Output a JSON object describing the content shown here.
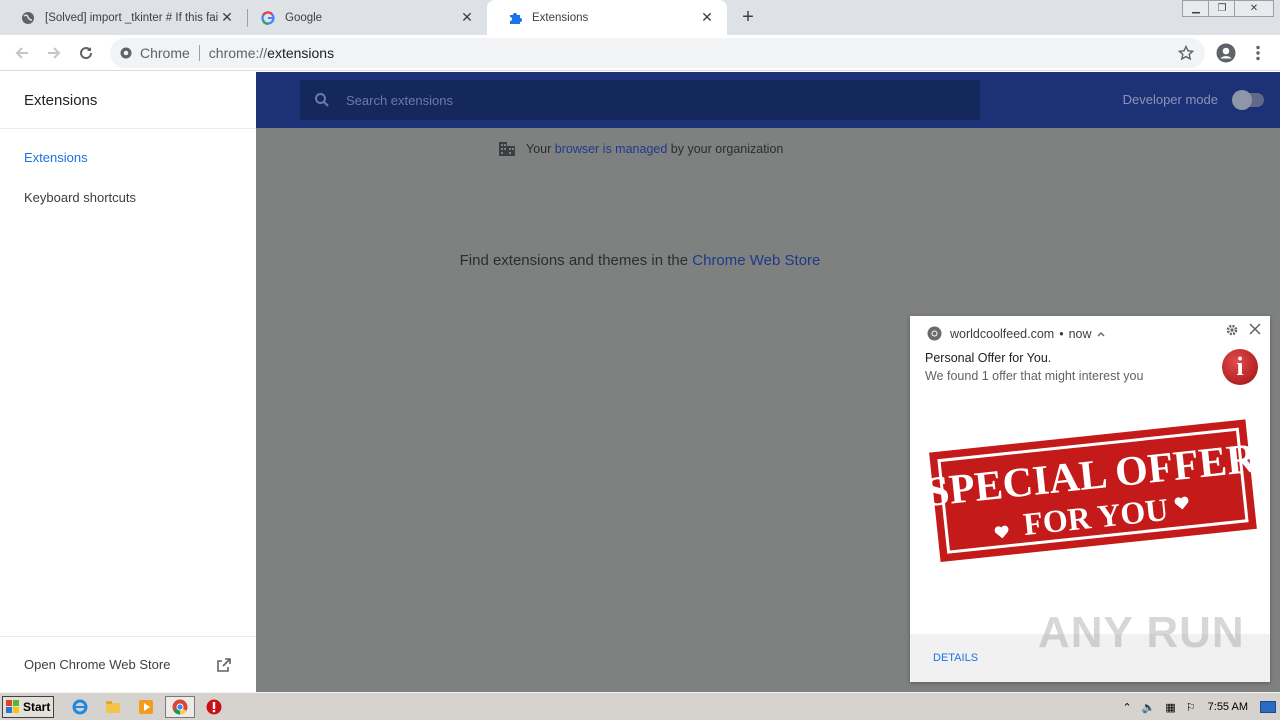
{
  "tabs": [
    {
      "title": "[Solved] import _tkinter # If this fails",
      "active": false,
      "favicon": "globe-icon"
    },
    {
      "title": "Google",
      "active": false,
      "favicon": "google-icon"
    },
    {
      "title": "Extensions",
      "active": true,
      "favicon": "puzzle-icon"
    }
  ],
  "toolbar": {
    "chip": "Chrome",
    "url_scheme": "chrome://",
    "url_host": "extensions"
  },
  "sidebar": {
    "title": "Extensions",
    "items": [
      {
        "label": "Extensions",
        "active": true
      },
      {
        "label": "Keyboard shortcuts",
        "active": false
      }
    ],
    "footer_label": "Open Chrome Web Store"
  },
  "header": {
    "search_placeholder": "Search extensions",
    "developer_mode_label": "Developer mode",
    "developer_mode_on": false
  },
  "main": {
    "managed_prefix": "Your",
    "managed_link": "browser is managed",
    "managed_suffix": "by your organization",
    "find_text": "Find extensions and themes in the",
    "find_link": "Chrome Web Store"
  },
  "notification": {
    "origin": "worldcoolfeed.com",
    "time": "now",
    "title": "Personal Offer for You.",
    "message": "We found 1 offer that might interest you",
    "banner_line1": "SPECIAL OFFER",
    "banner_line2": "FOR YOU",
    "details_label": "DETAILS"
  },
  "watermark": "ANY RUN",
  "taskbar": {
    "start_label": "Start",
    "clock": "7:55 AM"
  },
  "colors": {
    "accent": "#1a73e8",
    "header_dim": "#1d3276",
    "overlay": "#7e8180",
    "banner_red": "#c41a1a"
  }
}
